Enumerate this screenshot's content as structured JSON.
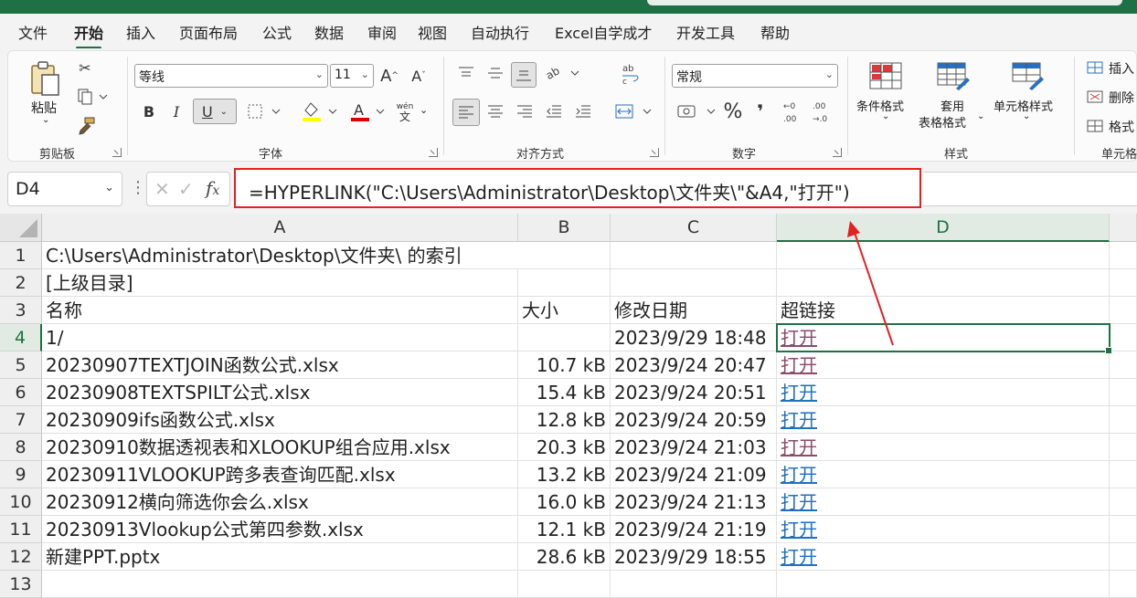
{
  "menu": {
    "tabs": [
      "文件",
      "开始",
      "插入",
      "页面布局",
      "公式",
      "数据",
      "审阅",
      "视图",
      "自动执行",
      "Excel自学成才",
      "开发工具",
      "帮助"
    ],
    "active": "开始"
  },
  "ribbon": {
    "clipboard": {
      "paste_label": "粘贴",
      "group_label": "剪贴板"
    },
    "font": {
      "name": "等线",
      "size": "11",
      "bold": "B",
      "italic": "I",
      "underline": "U",
      "phonetic_top": "wén",
      "phonetic_bottom": "文",
      "group_label": "字体",
      "font_color": "#e00000",
      "fill_color": "#ffff00"
    },
    "alignment": {
      "group_label": "对齐方式"
    },
    "number": {
      "format": "常规",
      "percent": "%",
      "comma": "❜",
      "group_label": "数字"
    },
    "styles": {
      "conditional": "条件格式",
      "table_format_1": "套用",
      "table_format_2": "表格格式",
      "cell_styles": "单元格样式",
      "group_label": "样式"
    },
    "cells": {
      "insert": "插入",
      "delete": "删除",
      "format": "格式",
      "group_label": "单元格"
    }
  },
  "formula_bar": {
    "name_box": "D4",
    "fx": "fx",
    "formula": "=HYPERLINK(\"C:\\Users\\Administrator\\Desktop\\文件夹\\\"&A4,\"打开\")"
  },
  "sheet": {
    "columns": [
      "A",
      "B",
      "C",
      "D"
    ],
    "selected_column": "D",
    "selected_row": "4",
    "rows": [
      {
        "n": "1",
        "a": "C:\\Users\\Administrator\\Desktop\\文件夹\\ 的索引",
        "b": "",
        "c": "",
        "d": "",
        "d_link": false,
        "d_visited": false
      },
      {
        "n": "2",
        "a": "[上级目录]",
        "b": "",
        "c": "",
        "d": "",
        "d_link": false,
        "d_visited": false
      },
      {
        "n": "3",
        "a": "名称",
        "b": "大小",
        "c": "修改日期",
        "d": "超链接",
        "d_link": false,
        "d_visited": false
      },
      {
        "n": "4",
        "a": "1/",
        "b": "",
        "c": "2023/9/29 18:48",
        "d": "打开",
        "d_link": true,
        "d_visited": true
      },
      {
        "n": "5",
        "a": "20230907TEXTJOIN函数公式.xlsx",
        "b": "10.7 kB",
        "c": "2023/9/24 20:47",
        "d": "打开",
        "d_link": true,
        "d_visited": true
      },
      {
        "n": "6",
        "a": "20230908TEXTSPILT公式.xlsx",
        "b": "15.4 kB",
        "c": "2023/9/24 20:51",
        "d": "打开",
        "d_link": true,
        "d_visited": false
      },
      {
        "n": "7",
        "a": "20230909ifs函数公式.xlsx",
        "b": "12.8 kB",
        "c": "2023/9/24 20:59",
        "d": "打开",
        "d_link": true,
        "d_visited": false
      },
      {
        "n": "8",
        "a": "20230910数据透视表和XLOOKUP组合应用.xlsx",
        "b": "20.3 kB",
        "c": "2023/9/24 21:03",
        "d": "打开",
        "d_link": true,
        "d_visited": true
      },
      {
        "n": "9",
        "a": "20230911VLOOKUP跨多表查询匹配.xlsx",
        "b": "13.2 kB",
        "c": "2023/9/24 21:09",
        "d": "打开",
        "d_link": true,
        "d_visited": false
      },
      {
        "n": "10",
        "a": "20230912横向筛选你会么.xlsx",
        "b": "16.0 kB",
        "c": "2023/9/24 21:13",
        "d": "打开",
        "d_link": true,
        "d_visited": false
      },
      {
        "n": "11",
        "a": "20230913Vlookup公式第四参数.xlsx",
        "b": "12.1 kB",
        "c": "2023/9/24 21:19",
        "d": "打开",
        "d_link": true,
        "d_visited": false
      },
      {
        "n": "12",
        "a": "新建PPT.pptx",
        "b": "28.6 kB",
        "c": "2023/9/29 18:55",
        "d": "打开",
        "d_link": true,
        "d_visited": false
      },
      {
        "n": "13",
        "a": "",
        "b": "",
        "c": "",
        "d": "",
        "d_link": false,
        "d_visited": false
      }
    ]
  },
  "colors": {
    "accent": "#1e7145",
    "annotation": "#e32121",
    "link": "#1f6fc0",
    "visited_link": "#8d4a6a"
  }
}
